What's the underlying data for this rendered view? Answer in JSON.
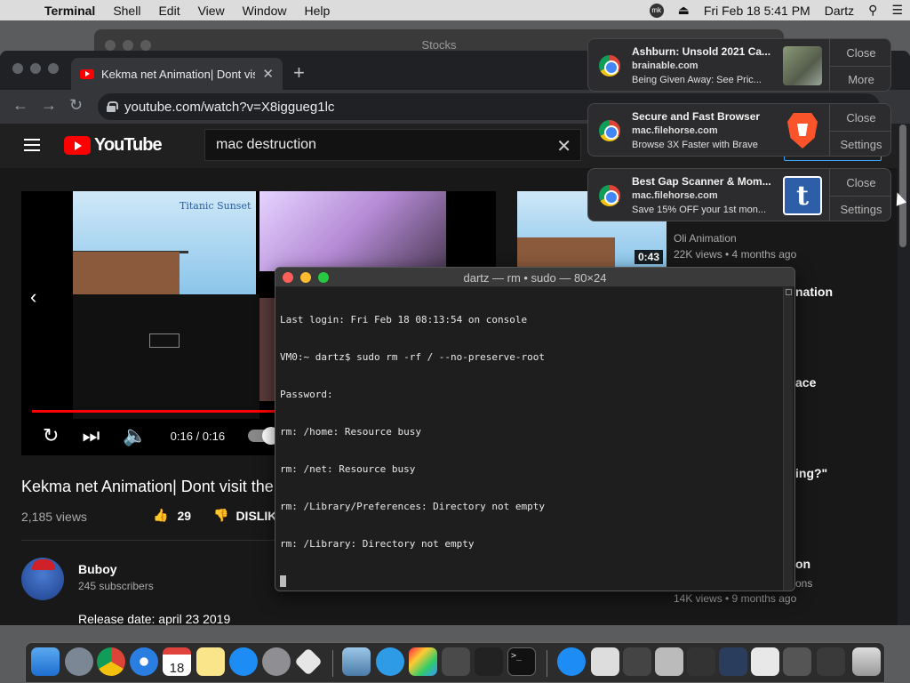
{
  "menubar": {
    "app_name": "Terminal",
    "items": [
      "Shell",
      "Edit",
      "View",
      "Window",
      "Help"
    ],
    "mk_label": "mk",
    "datetime": "Fri Feb 18  5:41 PM",
    "user": "Dartz"
  },
  "background_window": {
    "title": "Stocks"
  },
  "chrome": {
    "tab_title": "Kekma net Animation| Dont vis",
    "url": "youtube.com/watch?v=X8iggueg1lc"
  },
  "youtube": {
    "logo_text": "YouTube",
    "search_value": "mac destruction",
    "player": {
      "thumb_text": "Titanic Sunset",
      "time": "0:16 / 0:16",
      "progress": 1.0
    },
    "video_title": "Kekma net Animation| Dont visit the",
    "views": "2,185 views",
    "likes": "29",
    "dislike_label": "DISLIK",
    "channel": {
      "name": "Buboy",
      "subscribers": "245 subscribers"
    },
    "release_date": "Release date: april 23 2019",
    "sidebar": {
      "duration": "0:43",
      "channel": "Oli Animation",
      "meta": "22K views • 4 months ago",
      "frag1": "nation",
      "frag2": "ace",
      "frag3": "ing?\"",
      "frag4": "on",
      "frag5": "ons",
      "meta2": "14K views • 9 months ago"
    }
  },
  "terminal": {
    "title": "dartz — rm • sudo — 80×24",
    "lines": [
      "Last login: Fri Feb 18 08:13:54 on console",
      "VM0:~ dartz$ sudo rm -rf / --no-preserve-root",
      "Password:",
      "rm: /home: Resource busy",
      "rm: /net: Resource busy",
      "rm: /Library/Preferences: Directory not empty",
      "rm: /Library: Directory not empty"
    ]
  },
  "notifications": [
    {
      "title": "Ashburn: Unsold 2021 Ca...",
      "source": "brainable.com",
      "body": "Being Given Away: See Pric...",
      "action1": "Close",
      "action2": "More"
    },
    {
      "title": "Secure and Fast Browser",
      "source": "mac.filehorse.com",
      "body": "Browse 3X Faster with Brave",
      "action1": "Close",
      "action2": "Settings"
    },
    {
      "title": "Best Gap Scanner & Mom...",
      "source": "mac.filehorse.com",
      "body": "Save 15% OFF your 1st mon...",
      "action1": "Close",
      "action2": "Settings",
      "image_letter": "t"
    }
  ],
  "dock": {
    "calendar_day": "18",
    "terminal_glyph": ">_"
  },
  "colors": {
    "youtube_red": "#ff0000",
    "terminal_bg": "#1e1e1e",
    "notification_bg": "#2c2c2e",
    "chrome_dark": "#202124"
  }
}
